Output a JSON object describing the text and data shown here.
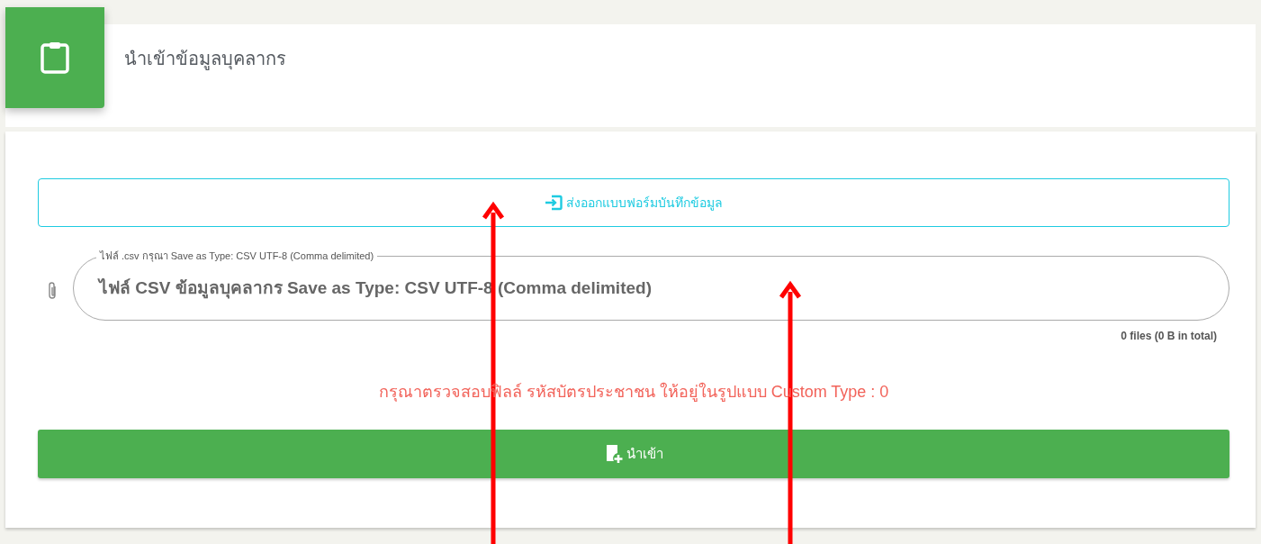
{
  "header": {
    "title": "นำเข้าข้อมูลบุคลากร"
  },
  "export_button": {
    "label": "ส่งออกแบบฟอร์มบันทึกข้อมูล"
  },
  "file_field": {
    "label": "ไฟล์ .csv กรุณา Save as Type: CSV UTF-8 (Comma delimited)",
    "placeholder": "ไฟล์ CSV ข้อมูลบุคลากร Save as Type: CSV UTF-8 (Comma delimited)",
    "summary": "0 files (0 B in total)"
  },
  "error_message": "กรุณาตรวจสอบฟิลล์ รหัสบัตรประชาชน ให้อยู่ในรูปแบบ Custom Type : 0",
  "import_button": {
    "label": "นำเข้า"
  }
}
